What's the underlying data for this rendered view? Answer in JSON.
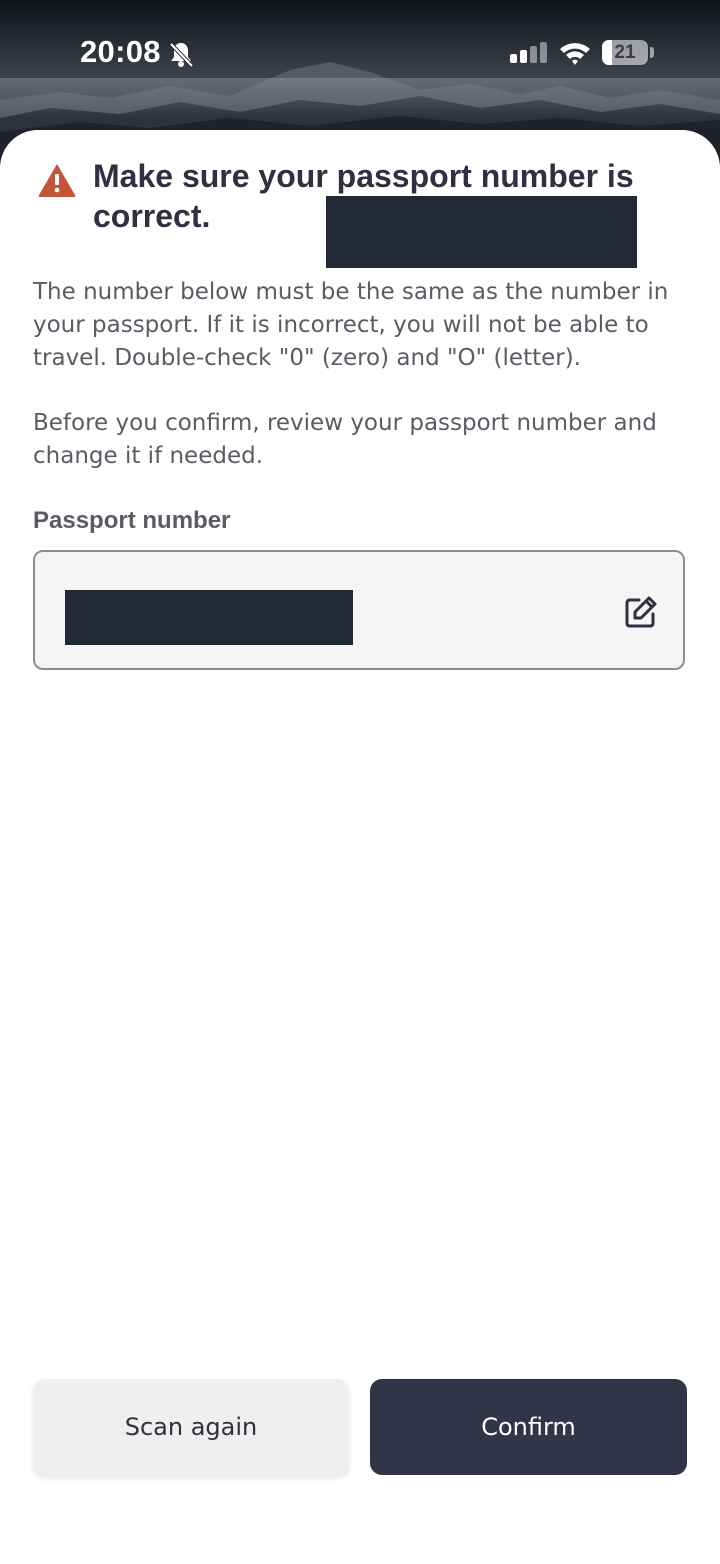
{
  "status_bar": {
    "time": "20:08",
    "battery_level": "21",
    "battery_fraction": 0.21,
    "icons": [
      "bell-slash-icon",
      "signal-icon",
      "wifi-icon",
      "battery-icon"
    ]
  },
  "warning": {
    "icon": "warning-icon",
    "icon_color": "#c4553a",
    "title": "Make sure your passport number is correct.",
    "paragraph_1": "The number below must be the same as the number in your passport. If it is incorrect, you will not be able to travel. Double-check \"0\" (zero) and \"O\" (letter).",
    "paragraph_2": "Before you confirm, review your passport number and change it if needed."
  },
  "passport_field": {
    "label": "Passport number",
    "value": "",
    "edit_icon": "edit-icon"
  },
  "buttons": {
    "scan_again": "Scan again",
    "confirm": "Confirm"
  },
  "colors": {
    "primary": "#323448",
    "title": "#2f3142",
    "body_text": "#5a5c64",
    "field_background": "#f5f5f5",
    "secondary_button": "#efefef"
  }
}
